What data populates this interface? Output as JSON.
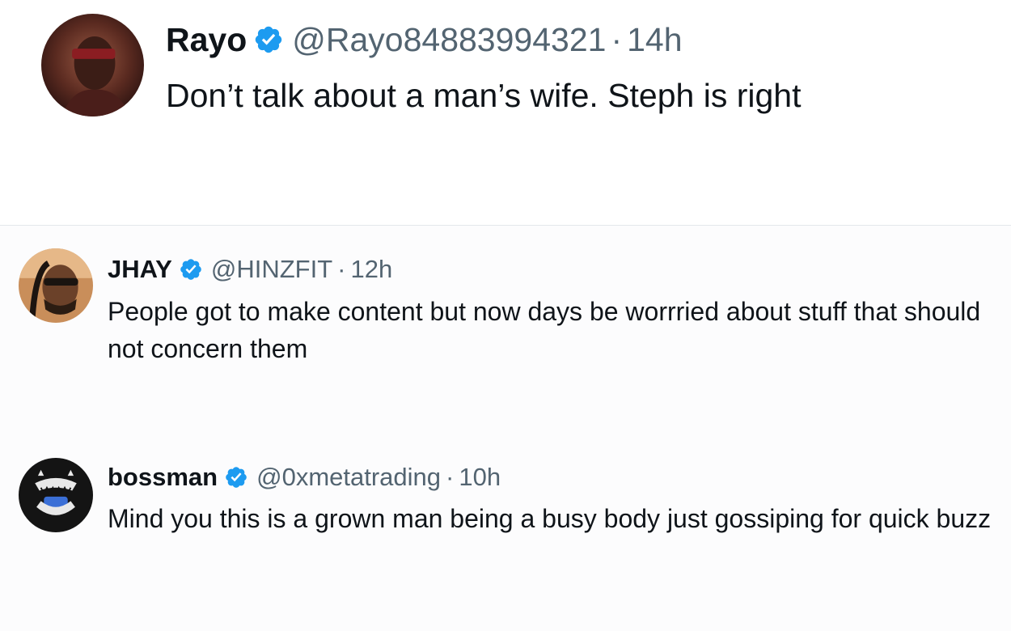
{
  "tweets": [
    {
      "display_name": "Rayo",
      "handle": "@Rayo84883994321",
      "separator": "·",
      "time": "14h",
      "text": "Don’t talk about a man’s wife. Steph is right",
      "verified": true,
      "avatar_icon": "user-avatar"
    },
    {
      "display_name": "JHAY",
      "handle": "@HINZFIT",
      "separator": "·",
      "time": "12h",
      "text": "People got to make content but now days be worrried about stuff that should not concern them",
      "verified": true,
      "avatar_icon": "user-avatar"
    },
    {
      "display_name": "bossman",
      "handle": "@0xmetatrading",
      "separator": "·",
      "time": "10h",
      "text": "Mind you this is a grown man being a busy body just gossiping for quick buzz",
      "verified": true,
      "avatar_icon": "user-avatar"
    }
  ],
  "icons": {
    "verified_badge": "verified-badge-icon"
  },
  "colors": {
    "verified_blue": "#1d9bf0",
    "text_primary": "#0f1419",
    "text_secondary": "#536471",
    "divider": "#e4e8eb"
  }
}
